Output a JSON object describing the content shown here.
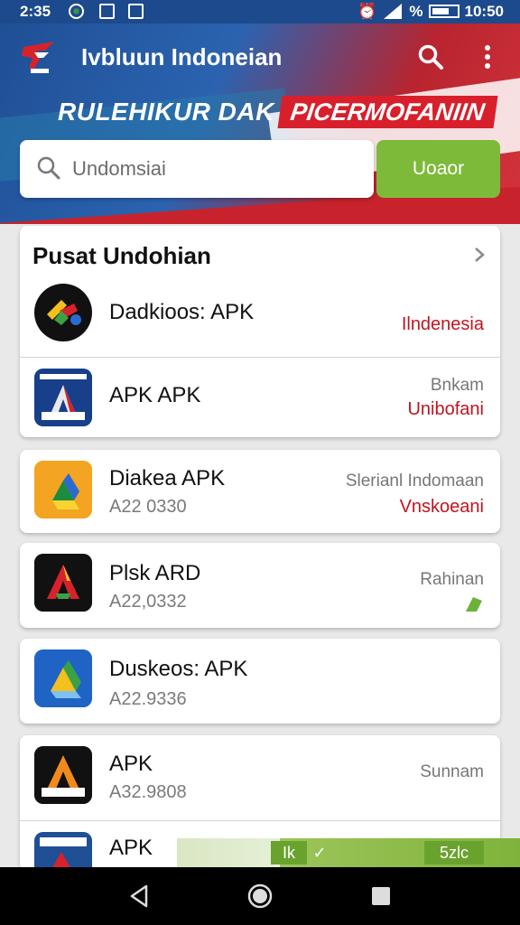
{
  "status_bar": {
    "time": "2:35",
    "clock": "10:50",
    "battery_label": "%"
  },
  "header": {
    "title": "Ivbluun  Indoneian",
    "banner_left": "RULEHIKUR DAK",
    "banner_right": "PICERMOFANIIN",
    "search": {
      "placeholder": "Undomsiai",
      "button_label": "Uoaor"
    }
  },
  "section": {
    "title": "Pusat Undohian",
    "items": [
      {
        "name": "Dadkioos: APK",
        "sub": "",
        "right_top": "",
        "right_red": "Ilndenesia",
        "icon": "multicolor-tools-icon"
      },
      {
        "name": "APK APK",
        "sub": "",
        "right_top": "Bnkam",
        "right_red": "Unibofani",
        "icon": "apk-a-logo-icon"
      }
    ]
  },
  "apps": [
    {
      "name": "Diakea APK",
      "sub": "A22 0330",
      "right_top": "Slerianl Indomaan",
      "right_red": "Vnskoeani",
      "icon": "drive-triangle-icon"
    },
    {
      "name": "Plsk ARD",
      "sub": "A22,0332",
      "right_top": "Rahinan",
      "right_red": "",
      "icon": "red-a-logo-icon",
      "right_icon": "leaf-icon"
    },
    {
      "name": "Duskeos: APK",
      "sub": "A22.9336",
      "right_top": "",
      "right_red": "",
      "icon": "blue-drive-icon"
    },
    {
      "name": "APK",
      "sub": "A32.9808",
      "right_top": "Sunnam",
      "right_red": "",
      "icon": "orange-a-logo-icon"
    },
    {
      "name": "APK",
      "sub": "",
      "right_top": "",
      "right_red": "",
      "icon": "blue-red-logo-icon"
    }
  ],
  "download_strip": {
    "left_label": "Ik",
    "check": "✓",
    "right_label": "5zlc"
  },
  "colors": {
    "accent_green": "#7dba3a",
    "brand_red": "#c0141f",
    "header_blue": "#1f4f95"
  }
}
